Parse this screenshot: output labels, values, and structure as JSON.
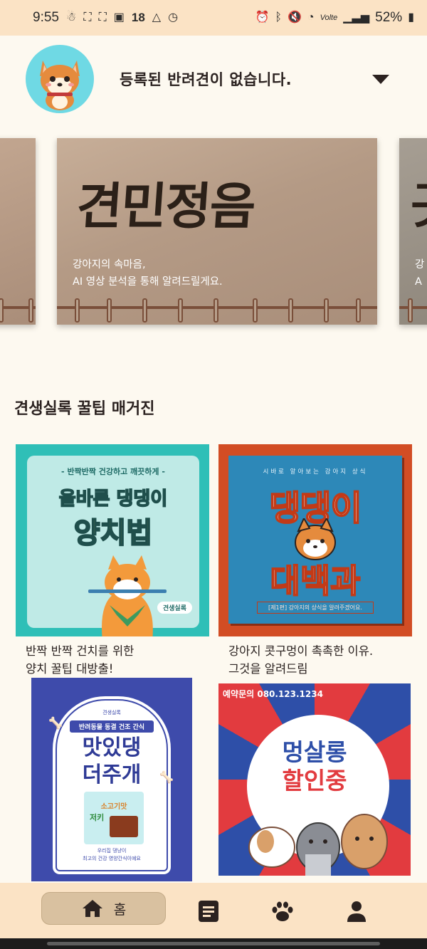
{
  "status_bar": {
    "time": "9:55",
    "notification_count": "18",
    "network": "Volte",
    "battery": "52%"
  },
  "header": {
    "dog_status": "등록된 반려견이 없습니다."
  },
  "banners": [
    {
      "title": "견민정음",
      "subtitle_line1": "강아지의 속마음,",
      "subtitle_line2": "AI 영상 분석을 통해 알려드릴게요.",
      "next_partial_char": "곳",
      "next_partial_line1": "강",
      "next_partial_line2": "A"
    }
  ],
  "magazine": {
    "section_title": "견생실록 꿀팁 매거진",
    "cards": [
      {
        "kicker": "- 반짝반짝 건강하고 깨끗하게 -",
        "headline_1": "올바른 댕댕이",
        "headline_2": "양치법",
        "brand": "견생실록",
        "caption_1": "반짝 반짝 건치를 위한",
        "caption_2": "양치 꿀팁 대방출!"
      },
      {
        "kicker": "시바로 알아보는 강아지 상식",
        "headline_1": "댕댕이",
        "headline_2": "대백과",
        "footer": "[제1편] 강아지의 상식을 알려주겠어요.",
        "caption_1": "강아지 콧구멍이 촉촉한 이유.",
        "caption_2": "그것을 알려드림"
      },
      {
        "kicker": "견생실록",
        "pill": "반려동물 동결 건조 간식",
        "headline_1": "맛있댕",
        "headline_2": "더주개",
        "pack_title": "소고기맛",
        "pack_sub": "저키",
        "footer_1": "우리집 댕냥이",
        "footer_2": "최고의 건강 영양간식이예요"
      },
      {
        "phone": "예약문의 080.123.1234",
        "headline_1": "멍살롱",
        "headline_2": "할인중"
      }
    ]
  },
  "bottom_nav": {
    "home_label": "홈"
  },
  "colors": {
    "background": "#fdf9f0",
    "status_bar": "#fbe3c5",
    "nav_active": "#d9c1a0",
    "text": "#2b2220"
  }
}
